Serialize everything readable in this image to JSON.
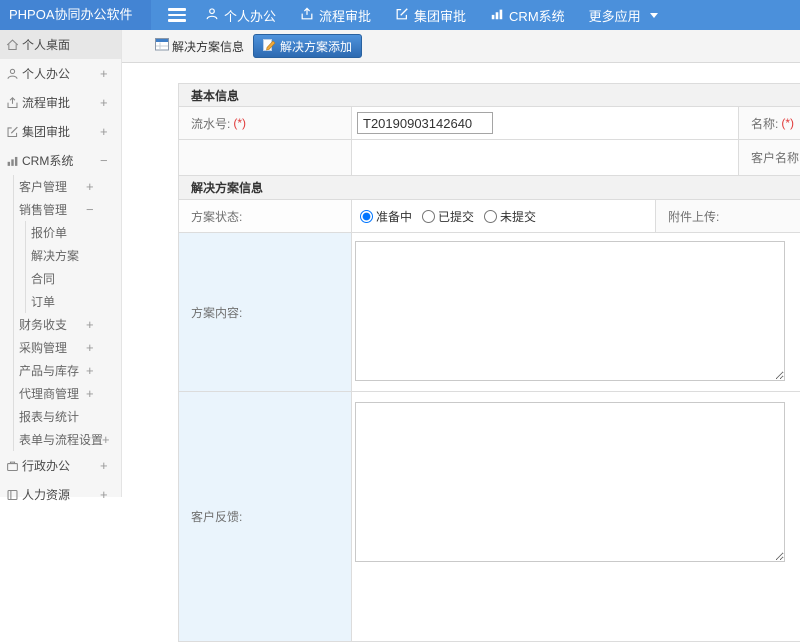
{
  "app": {
    "title": "PHPOA协同办公软件"
  },
  "topnav": {
    "items": [
      {
        "label": "个人办公"
      },
      {
        "label": "流程审批"
      },
      {
        "label": "集团审批"
      },
      {
        "label": "CRM系统"
      },
      {
        "label": "更多应用"
      }
    ]
  },
  "sidebar": {
    "items": [
      {
        "label": "个人桌面"
      },
      {
        "label": "个人办公",
        "toggle": "+"
      },
      {
        "label": "流程审批",
        "toggle": "+"
      },
      {
        "label": "集团审批",
        "toggle": "+"
      },
      {
        "label": "CRM系统",
        "toggle": "−"
      },
      {
        "label": "客户管理",
        "toggle": "+"
      },
      {
        "label": "销售管理",
        "toggle": "−"
      },
      {
        "label": "报价单"
      },
      {
        "label": "解决方案"
      },
      {
        "label": "合同"
      },
      {
        "label": "订单"
      },
      {
        "label": "财务收支",
        "toggle": "+"
      },
      {
        "label": "采购管理",
        "toggle": "+"
      },
      {
        "label": "产品与库存",
        "toggle": "+"
      },
      {
        "label": "代理商管理",
        "toggle": "+"
      },
      {
        "label": "报表与统计"
      },
      {
        "label": "表单与流程设置",
        "toggle": "+"
      },
      {
        "label": "行政办公",
        "toggle": "+"
      },
      {
        "label": "人力资源",
        "toggle": "+"
      }
    ]
  },
  "tabs": {
    "info": "解决方案信息",
    "add": "解决方案添加"
  },
  "form": {
    "section_basic": "基本信息",
    "serial_label": "流水号:",
    "required_mark": "(*)",
    "serial_value": "T20190903142640",
    "name_label": "名称:",
    "customer_name_label": "客户名称:",
    "section_solution": "解决方案信息",
    "status_label": "方案状态:",
    "status_options": [
      "准备中",
      "已提交",
      "未提交"
    ],
    "attachment_label": "附件上传:",
    "content_label": "方案内容:",
    "feedback_label": "客户反馈:"
  },
  "colors": {
    "topbar": "#4b90db",
    "logo_bg": "#4384d3",
    "active_tab": "#2d6ab1",
    "required": "#e03a3a",
    "label_cell_blue": "#eaf4fc"
  }
}
